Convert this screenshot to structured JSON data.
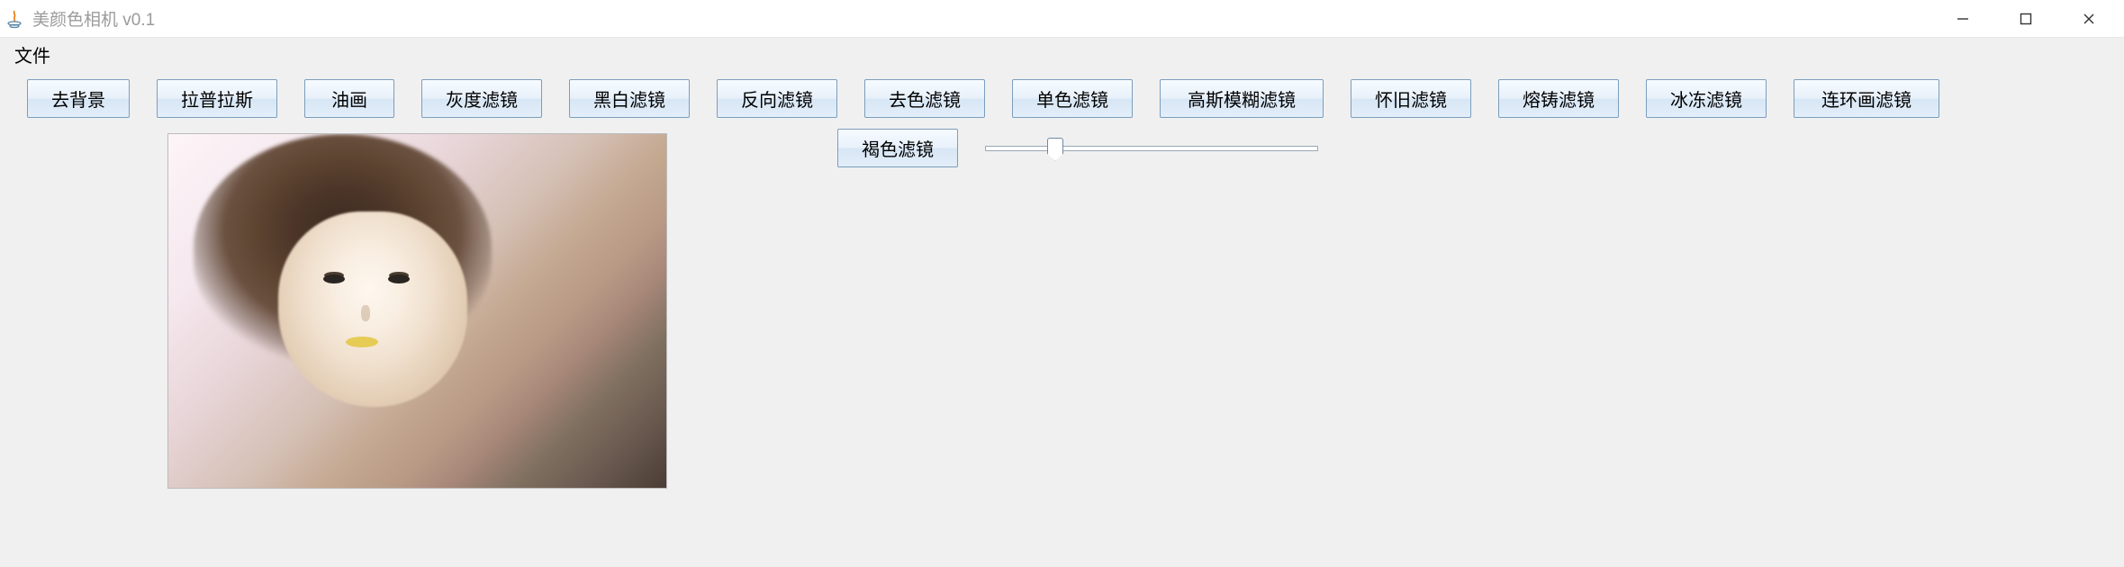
{
  "window": {
    "title": "美颜色相机 v0.1"
  },
  "menu": {
    "file": "文件"
  },
  "toolbar": {
    "buttons": [
      "去背景",
      "拉普拉斯",
      "油画",
      "灰度滤镜",
      "黑白滤镜",
      "反向滤镜",
      "去色滤镜",
      "单色滤镜",
      "高斯模糊滤镜",
      "怀旧滤镜",
      "熔铸滤镜",
      "冰冻滤镜",
      "连环画滤镜"
    ],
    "sepia_button": "褐色滤镜"
  },
  "slider": {
    "value": 20,
    "min": 0,
    "max": 100
  }
}
